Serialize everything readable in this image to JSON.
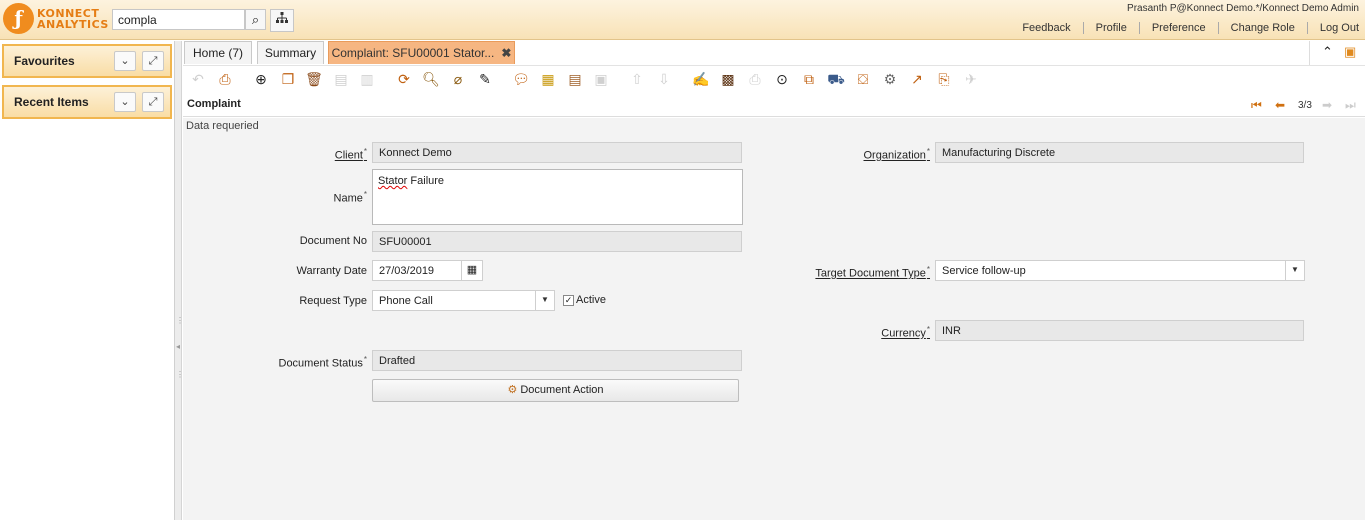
{
  "header": {
    "logo_mark": "ƒ",
    "logo_line1": "KONNECT",
    "logo_line2": "ANALYTICS",
    "search_value": "compla",
    "search_icon": "search-icon",
    "tree_icon": "sitemap-icon",
    "user": "Prasanth P@Konnect Demo.*/Konnect Demo Admin",
    "links": [
      "Feedback",
      "Profile",
      "Preference",
      "Change Role",
      "Log Out"
    ],
    "accent_color": "#f08c1e"
  },
  "sidebar": {
    "favourites": "Favourites",
    "recent_items": "Recent Items"
  },
  "tabs": [
    {
      "label": "Home (7)"
    },
    {
      "label": "Summary"
    },
    {
      "label": "Complaint: SFU00001 Stator..."
    }
  ],
  "tab_close": "✖",
  "window": {
    "title": "Complaint",
    "record_count": "3/3",
    "status_message": "Data requeried"
  },
  "form": {
    "client_label": "Client",
    "client_value": "Konnect Demo",
    "organization_label": "Organization",
    "organization_value": "Manufacturing Discrete",
    "name_label": "Name",
    "name_value_word1": "Stator",
    "name_value_word2": " Failure",
    "document_no_label": "Document No",
    "document_no_value": "SFU00001",
    "warranty_date_label": "Warranty Date",
    "warranty_date_value": "27/03/2019",
    "target_doc_type_label": "Target Document Type",
    "target_doc_type_value": "Service follow-up",
    "request_type_label": "Request Type",
    "request_type_value": "Phone Call",
    "active_label": "Active",
    "active_checked": true,
    "currency_label": "Currency",
    "currency_value": "INR",
    "document_status_label": "Document Status",
    "document_status_value": "Drafted",
    "document_action_label": "Document Action"
  }
}
